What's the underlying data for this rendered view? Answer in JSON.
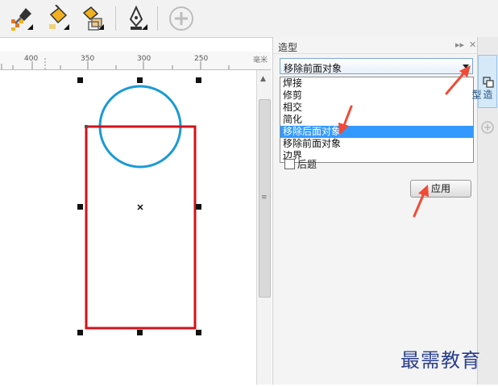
{
  "toolbar": {
    "buttons": [
      {
        "icon": "eyedropper-fill-icon"
      },
      {
        "icon": "paint-bucket-icon"
      },
      {
        "icon": "attribute-bucket-icon"
      },
      {
        "icon": "pen-nib-icon"
      },
      {
        "icon": "add-circle-icon"
      }
    ]
  },
  "ruler": {
    "labels": [
      "400",
      "350",
      "300",
      "250"
    ],
    "unit": "毫米"
  },
  "docker": {
    "title": "造型",
    "selected_mode": "移除前面对象",
    "options": [
      "焊接",
      "修剪",
      "相交",
      "简化",
      "移除后面对象",
      "移除前面对象",
      "边界"
    ],
    "highlighted_option": "移除后面对象",
    "partial_checkbox_label": "后题",
    "apply_label": "应用"
  },
  "tabstrip": {
    "active_tab_label": "造型"
  },
  "canvas": {
    "circle_color": "#1a9ad6",
    "rect_color": "#d0121b"
  },
  "annotation_color": "#f04b36",
  "watermark": "最需教育"
}
